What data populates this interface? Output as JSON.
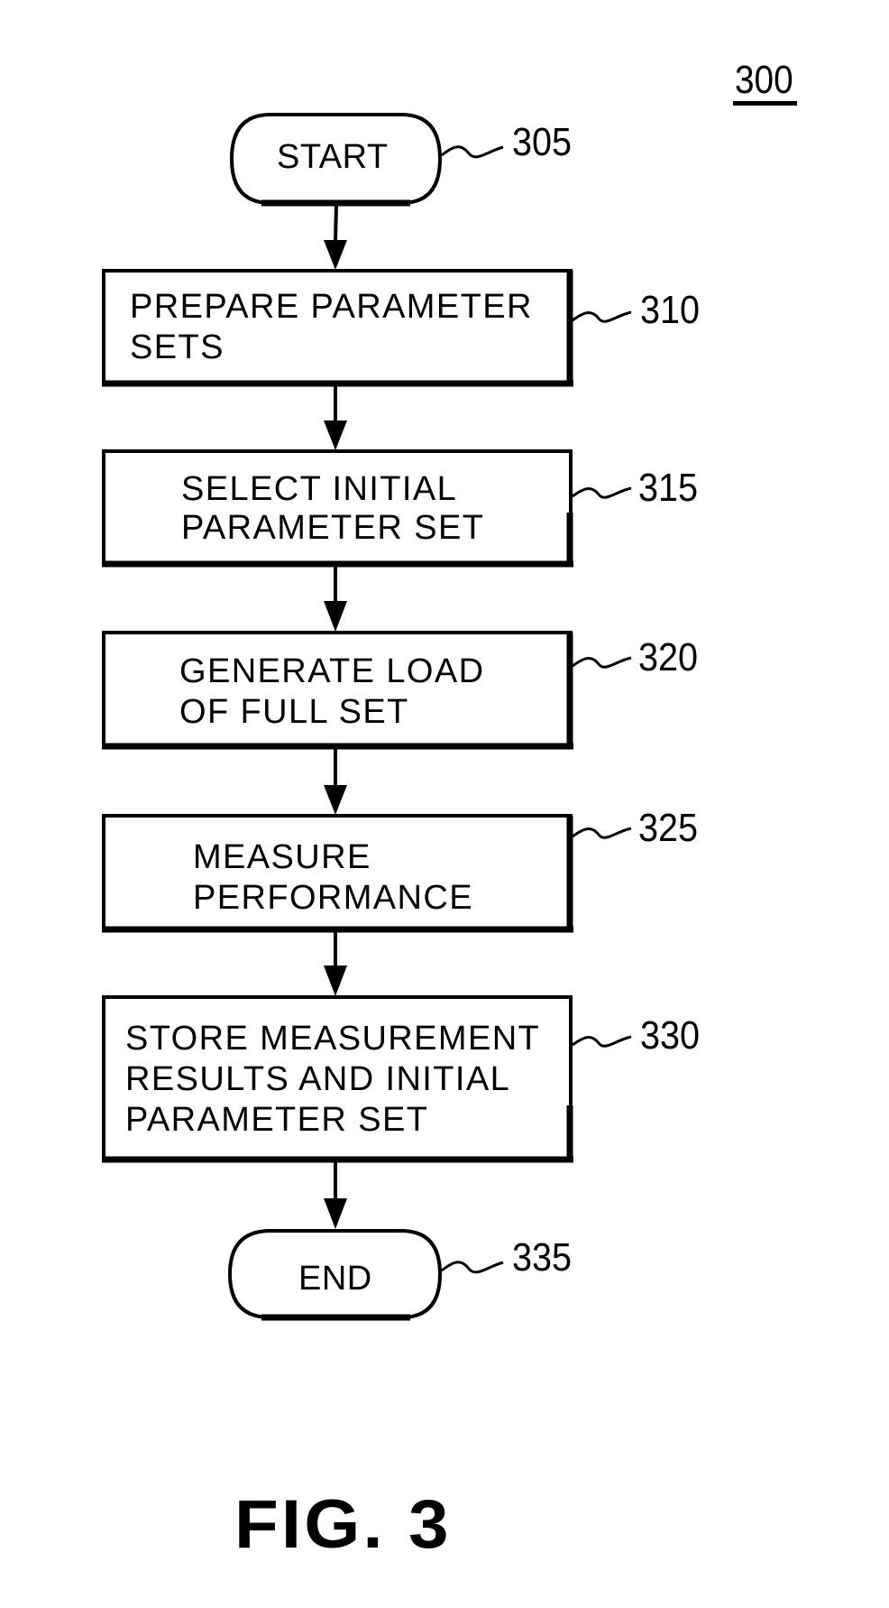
{
  "figure": {
    "diagram_id": "300",
    "caption": "FIG. 3"
  },
  "flowchart": {
    "start": {
      "label": "START",
      "ref": "305"
    },
    "steps": [
      {
        "ref": "310",
        "lines": [
          "PREPARE PARAMETER",
          "SETS"
        ]
      },
      {
        "ref": "315",
        "lines": [
          "SELECT INITIAL",
          "PARAMETER SET"
        ]
      },
      {
        "ref": "320",
        "lines": [
          "GENERATE LOAD",
          "OF FULL SET"
        ]
      },
      {
        "ref": "325",
        "lines": [
          "MEASURE",
          "PERFORMANCE"
        ]
      },
      {
        "ref": "330",
        "lines": [
          "STORE MEASUREMENT",
          "RESULTS AND INITIAL",
          "PARAMETER SET"
        ]
      }
    ],
    "end": {
      "label": "END",
      "ref": "335"
    }
  },
  "colors": {
    "ink": "#000000",
    "paper": "#ffffff"
  }
}
